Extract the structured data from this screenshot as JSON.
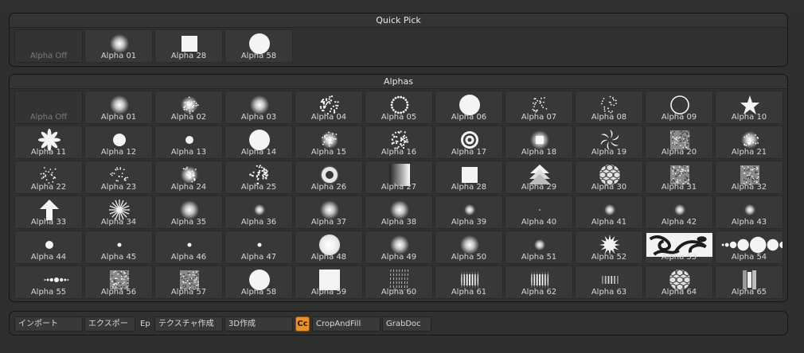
{
  "quick_pick": {
    "title": "Quick Pick",
    "items": [
      {
        "label": "Alpha Off",
        "glyph": "none"
      },
      {
        "label": "Alpha 01",
        "glyph": "soft"
      },
      {
        "label": "Alpha 28",
        "glyph": "square"
      },
      {
        "label": "Alpha 58",
        "glyph": "disc"
      }
    ]
  },
  "alphas": {
    "title": "Alphas",
    "items": [
      {
        "label": "Alpha Off",
        "glyph": "none"
      },
      {
        "label": "Alpha 01",
        "glyph": "soft"
      },
      {
        "label": "Alpha 02",
        "glyph": "fuzzy"
      },
      {
        "label": "Alpha 03",
        "glyph": "soft"
      },
      {
        "label": "Alpha 04",
        "glyph": "speckle"
      },
      {
        "label": "Alpha 05",
        "glyph": "dotring"
      },
      {
        "label": "Alpha 06",
        "glyph": "disc"
      },
      {
        "label": "Alpha 07",
        "glyph": "scatter"
      },
      {
        "label": "Alpha 08",
        "glyph": "scatter"
      },
      {
        "label": "Alpha 09",
        "glyph": "ring"
      },
      {
        "label": "Alpha 10",
        "glyph": "star"
      },
      {
        "label": "Alpha 11",
        "glyph": "pinwheel"
      },
      {
        "label": "Alpha 12",
        "glyph": "disc-sm"
      },
      {
        "label": "Alpha 13",
        "glyph": "dot"
      },
      {
        "label": "Alpha 14",
        "glyph": "disc"
      },
      {
        "label": "Alpha 15",
        "glyph": "fuzzy"
      },
      {
        "label": "Alpha 16",
        "glyph": "speckle"
      },
      {
        "label": "Alpha 17",
        "glyph": "target"
      },
      {
        "label": "Alpha 18",
        "glyph": "glowsquare"
      },
      {
        "label": "Alpha 19",
        "glyph": "swirl"
      },
      {
        "label": "Alpha 20",
        "glyph": "noisysquare"
      },
      {
        "label": "Alpha 21",
        "glyph": "fuzzy"
      },
      {
        "label": "Alpha 22",
        "glyph": "scatter"
      },
      {
        "label": "Alpha 23",
        "glyph": "scatter"
      },
      {
        "label": "Alpha 24",
        "glyph": "fuzzy"
      },
      {
        "label": "Alpha 25",
        "glyph": "speckle"
      },
      {
        "label": "Alpha 26",
        "glyph": "donut"
      },
      {
        "label": "Alpha 27",
        "glyph": "gradient"
      },
      {
        "label": "Alpha 28",
        "glyph": "square"
      },
      {
        "label": "Alpha 29",
        "glyph": "tree"
      },
      {
        "label": "Alpha 30",
        "glyph": "cells"
      },
      {
        "label": "Alpha 31",
        "glyph": "noisysquare"
      },
      {
        "label": "Alpha 32",
        "glyph": "noisysquare"
      },
      {
        "label": "Alpha 33",
        "glyph": "arrow"
      },
      {
        "label": "Alpha 34",
        "glyph": "rays"
      },
      {
        "label": "Alpha 35",
        "glyph": "soft"
      },
      {
        "label": "Alpha 36",
        "glyph": "soft-sm"
      },
      {
        "label": "Alpha 37",
        "glyph": "soft"
      },
      {
        "label": "Alpha 38",
        "glyph": "soft"
      },
      {
        "label": "Alpha 39",
        "glyph": "soft-sm"
      },
      {
        "label": "Alpha 40",
        "glyph": "pixel"
      },
      {
        "label": "Alpha 41",
        "glyph": "soft-sm"
      },
      {
        "label": "Alpha 42",
        "glyph": "soft-sm"
      },
      {
        "label": "Alpha 43",
        "glyph": "soft-sm"
      },
      {
        "label": "Alpha 44",
        "glyph": "dot"
      },
      {
        "label": "Alpha 45",
        "glyph": "dot-xs"
      },
      {
        "label": "Alpha 46",
        "glyph": "dot-xs"
      },
      {
        "label": "Alpha 47",
        "glyph": "dot-xs"
      },
      {
        "label": "Alpha 48",
        "glyph": "bigsoft"
      },
      {
        "label": "Alpha 49",
        "glyph": "soft"
      },
      {
        "label": "Alpha 50",
        "glyph": "soft"
      },
      {
        "label": "Alpha 51",
        "glyph": "soft-sm"
      },
      {
        "label": "Alpha 52",
        "glyph": "burst"
      },
      {
        "label": "Alpha 53",
        "glyph": "pattern"
      },
      {
        "label": "Alpha 54",
        "glyph": "dotline"
      },
      {
        "label": "Alpha 55",
        "glyph": "dotline-sm"
      },
      {
        "label": "Alpha 56",
        "glyph": "noisysquare"
      },
      {
        "label": "Alpha 57",
        "glyph": "noisysquare"
      },
      {
        "label": "Alpha 58",
        "glyph": "disc"
      },
      {
        "label": "Alpha 59",
        "glyph": "square-lg"
      },
      {
        "label": "Alpha 60",
        "glyph": "drips"
      },
      {
        "label": "Alpha 61",
        "glyph": "bars"
      },
      {
        "label": "Alpha 62",
        "glyph": "bars"
      },
      {
        "label": "Alpha 63",
        "glyph": "bars-sm"
      },
      {
        "label": "Alpha 64",
        "glyph": "cells"
      },
      {
        "label": "Alpha 65",
        "glyph": "panels"
      }
    ]
  },
  "footer": {
    "import_label": "インポート",
    "export_label": "エクスポー",
    "ep_label": "Ep",
    "make_texture_label": "テクスチャ作成",
    "make_3d_label": "3D作成",
    "cc_label": "Cc",
    "crop_and_fill_label": "CropAndFill",
    "grabdoc_label": "GrabDoc"
  },
  "colors": {
    "background": "#2f2f2f",
    "tile": "#383838",
    "accent": "#e8902a",
    "text": "#d9d9d9"
  }
}
